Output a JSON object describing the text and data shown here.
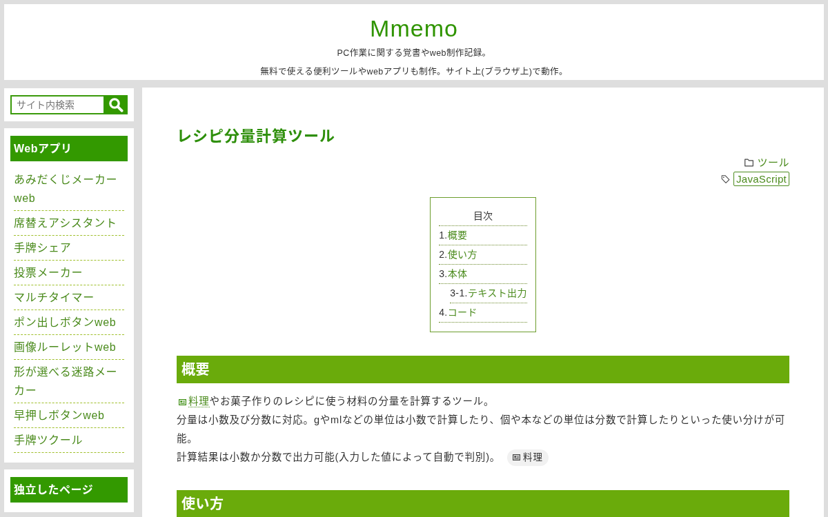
{
  "header": {
    "title": "Mmemo",
    "descriptions": [
      "PC作業に関する覚書やweb制作記録。",
      "無料で使える便利ツールやwebアプリも制作。サイト上(ブラウザ上)で動作。"
    ]
  },
  "sidebar": {
    "search": {
      "placeholder": "サイト内検索"
    },
    "widgets": [
      {
        "heading": "Webアプリ",
        "items": [
          "あみだくじメーカーweb",
          "席替えアシスタント",
          "手牌シェア",
          "投票メーカー",
          "マルチタイマー",
          "ポン出しボタンweb",
          "画像ルーレットweb",
          "形が選べる迷路メーカー",
          "早押しボタンweb",
          "手牌ツクール"
        ]
      },
      {
        "heading": "独立したページ"
      }
    ]
  },
  "article": {
    "title": "レシピ分量計算ツール",
    "category": "ツール",
    "tags": [
      "JavaScript"
    ],
    "toc": {
      "title": "目次",
      "items": [
        {
          "number": "1.",
          "label": "概要"
        },
        {
          "number": "2.",
          "label": "使い方"
        },
        {
          "number": "3.",
          "label": "本体",
          "children": [
            {
              "number": "3-1.",
              "label": "テキスト出力"
            }
          ]
        },
        {
          "number": "4.",
          "label": "コード"
        }
      ]
    },
    "sections": [
      {
        "heading": "概要",
        "lines": [
          {
            "link": "料理",
            "text": "やお菓子作りのレシピに使う材料の分量を計算するツール。"
          },
          {
            "text": "分量は小数及び分数に対応。gやmlなどの単位は小数で計算したり、個や本などの単位は分数で計算したりといった使い分けが可能。"
          },
          {
            "text": "計算結果は小数か分数で出力可能(入力した値によって自動で判別)。",
            "tag": "料理"
          }
        ]
      },
      {
        "heading": "使い方"
      }
    ]
  }
}
